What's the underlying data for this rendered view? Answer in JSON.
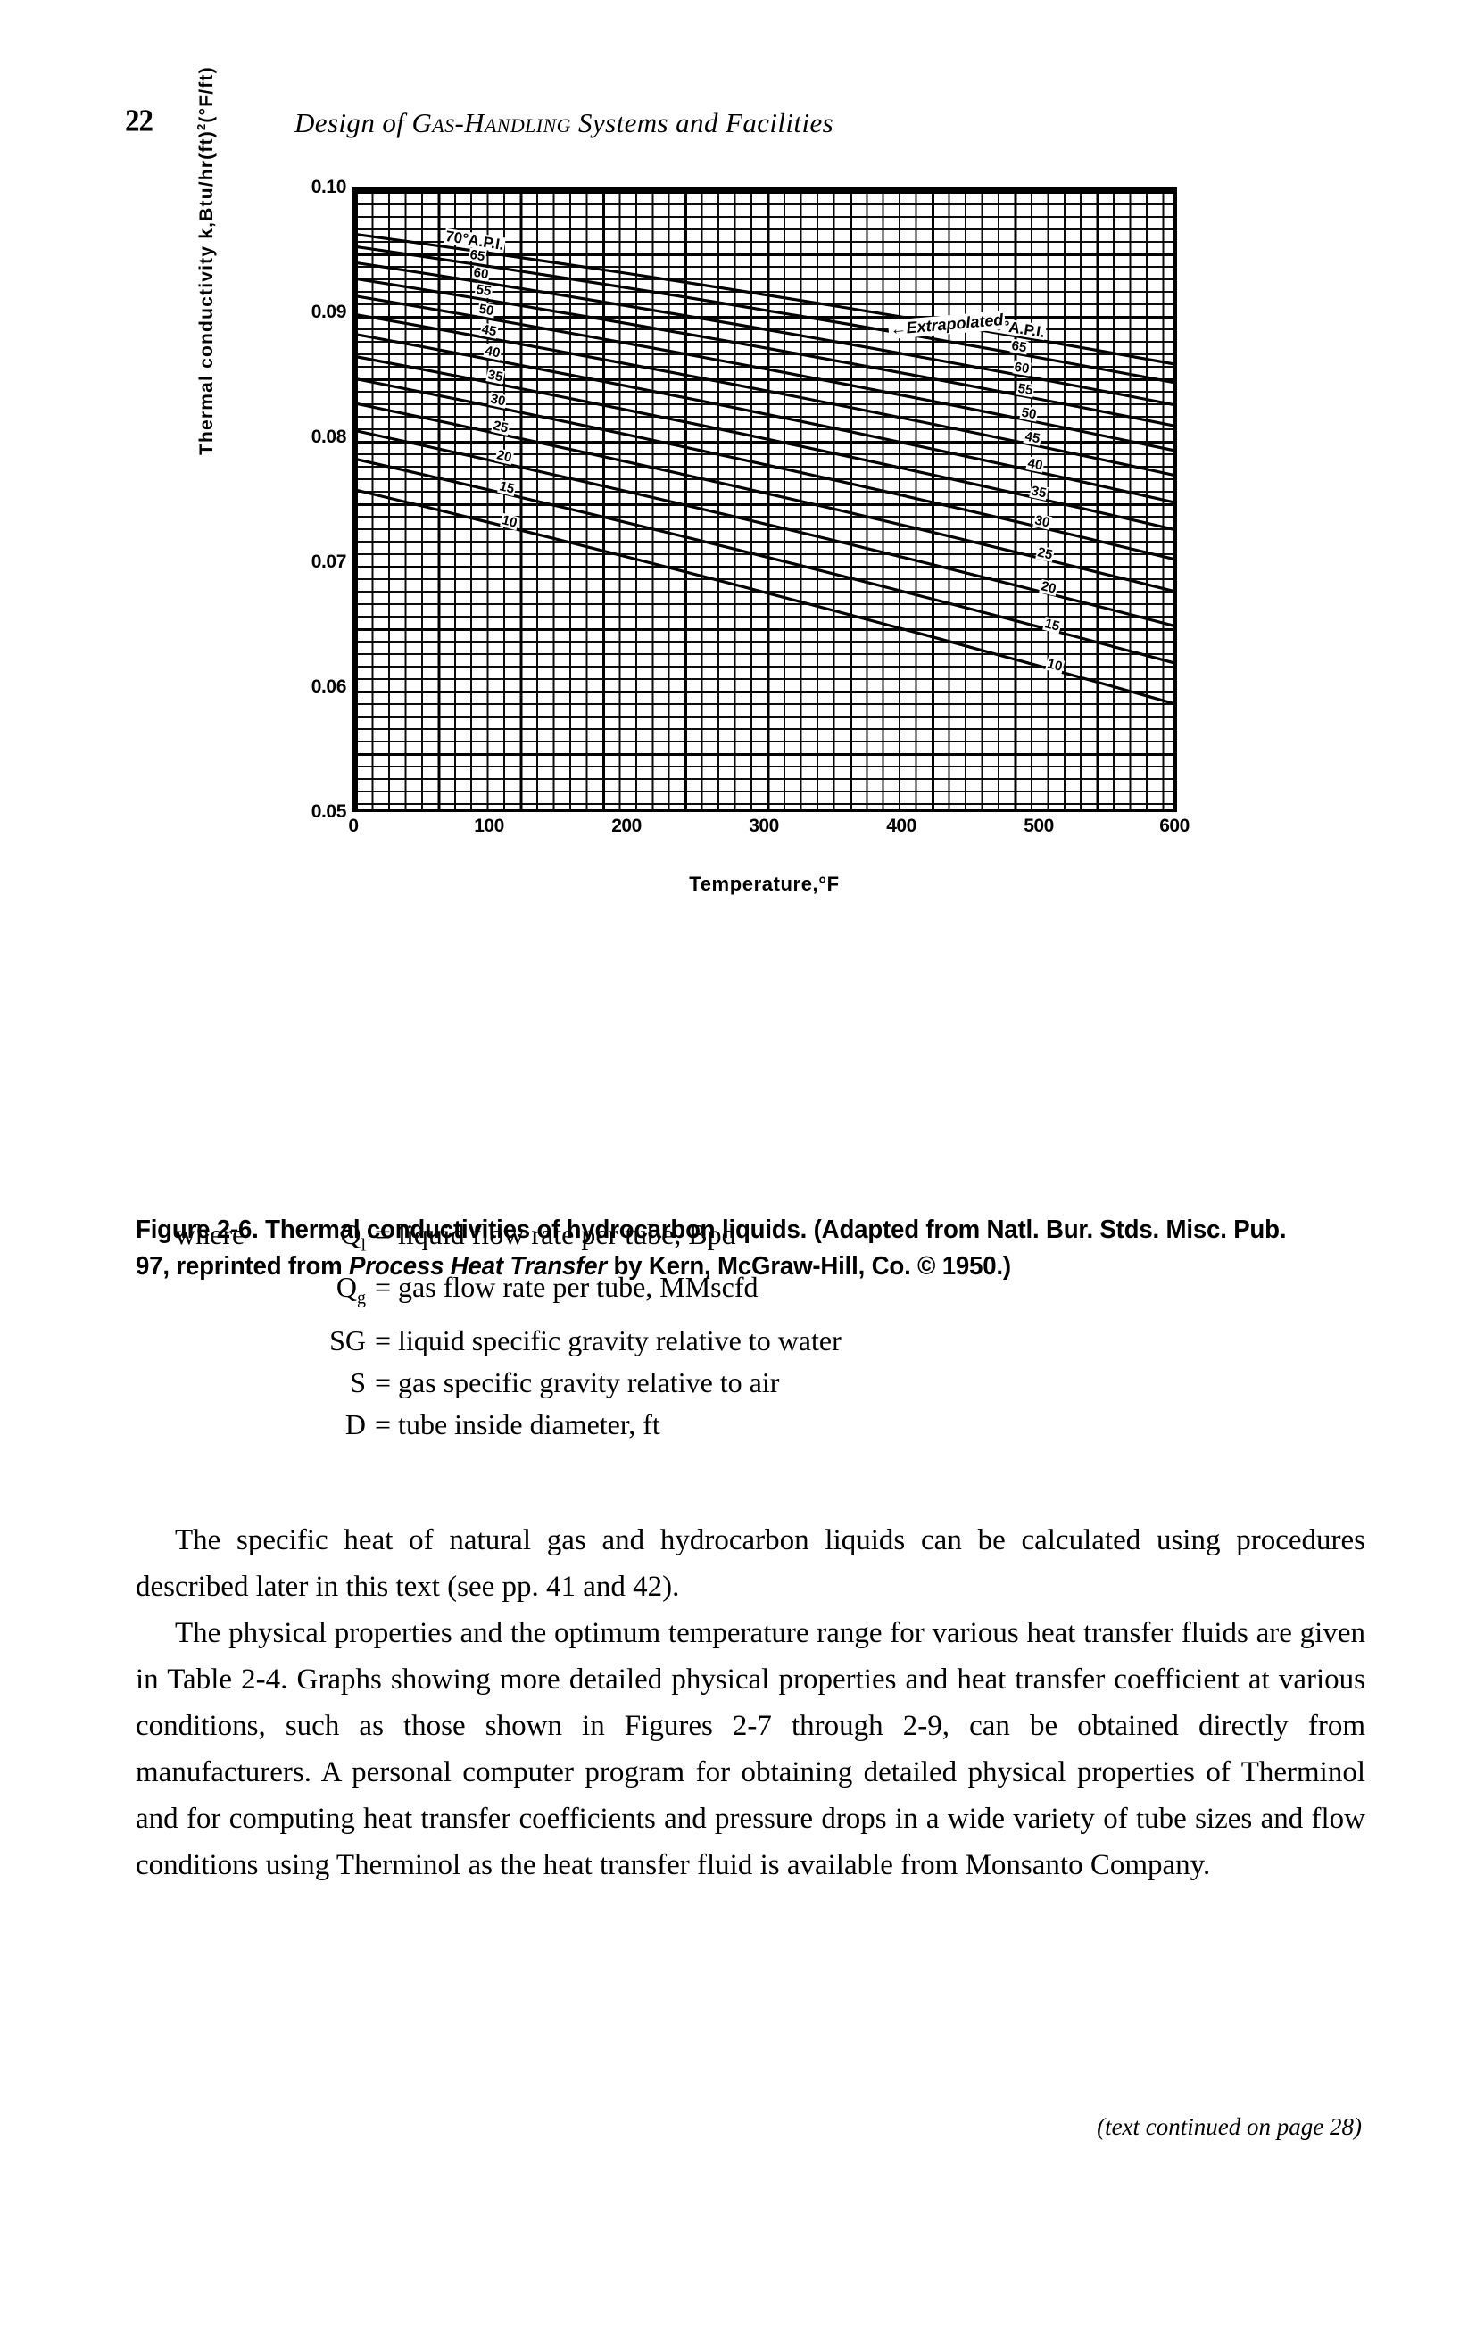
{
  "page": {
    "folio": "22",
    "running_head_prefix": "Design of ",
    "running_head_smallcaps": "Gas-Handling",
    "running_head_suffix": " Systems and Facilities",
    "footer_note": "(text continued on page 28)"
  },
  "figure": {
    "caption_line1": "Figure 2-6. Thermal conductivities of hydrocarbon liquids. (Adapted from Natl. Bur.",
    "caption_line2_a": "Stds. Misc. Pub. 97, reprinted from ",
    "caption_line2_italic": "Process Heat Transfer",
    "caption_line2_b": " by Kern, McGraw-Hill,",
    "caption_line3": "Co. © 1950.)",
    "annotation_extrapolated": "Extrapolated",
    "annotation_arrow": "←"
  },
  "chart_data": {
    "type": "line",
    "title": "Thermal conductivities of hydrocarbon liquids",
    "xlabel": "Temperature,°F",
    "ylabel_main": "Thermal conductivity ",
    "ylabel_units_pre": "k,Btu/hr(ft)",
    "ylabel_units_sup": "2",
    "ylabel_units_post": "(°F/ft)",
    "xlim": [
      0,
      600
    ],
    "ylim": [
      0.05,
      0.1
    ],
    "xticks": [
      0,
      100,
      200,
      300,
      400,
      500,
      600
    ],
    "xticklabels": [
      "0",
      "100",
      "200",
      "300",
      "400",
      "500",
      "600"
    ],
    "yticks": [
      0.1,
      0.09,
      0.08,
      0.07,
      0.06,
      0.05
    ],
    "yticklabels": [
      "0.10",
      "0.09",
      "0.08",
      "0.07",
      "0.06",
      "0.05"
    ],
    "grid": true,
    "grid_minor": true,
    "legend": "inline-curve-labels",
    "series_unit": "°API gravity",
    "series": [
      {
        "name": "70°A.P.I.",
        "label_left": "70°A.P.I.",
        "label_right": "70°A.P.I.",
        "x": [
          0,
          600
        ],
        "values": [
          0.0965,
          0.086
        ]
      },
      {
        "name": "65",
        "label_left": "65",
        "label_right": "65",
        "x": [
          0,
          600
        ],
        "values": [
          0.0955,
          0.0845
        ]
      },
      {
        "name": "60",
        "label_left": "60",
        "label_right": "60",
        "x": [
          0,
          600
        ],
        "values": [
          0.0942,
          0.0827
        ]
      },
      {
        "name": "55",
        "label_left": "55",
        "label_right": "55",
        "x": [
          0,
          600
        ],
        "values": [
          0.0929,
          0.081
        ]
      },
      {
        "name": "50",
        "label_left": "50",
        "label_right": "50",
        "x": [
          0,
          600
        ],
        "values": [
          0.0915,
          0.079
        ]
      },
      {
        "name": "45",
        "label_left": "45",
        "label_right": "45",
        "x": [
          0,
          600
        ],
        "values": [
          0.09,
          0.077
        ]
      },
      {
        "name": "40",
        "label_left": "40",
        "label_right": "40",
        "x": [
          0,
          600
        ],
        "values": [
          0.0884,
          0.0748
        ]
      },
      {
        "name": "35",
        "label_left": "35",
        "label_right": "35",
        "x": [
          0,
          600
        ],
        "values": [
          0.0866,
          0.0726
        ]
      },
      {
        "name": "30",
        "label_left": "30",
        "label_right": "30",
        "x": [
          0,
          600
        ],
        "values": [
          0.0848,
          0.0702
        ]
      },
      {
        "name": "25",
        "label_left": "25",
        "label_right": "25",
        "x": [
          0,
          600
        ],
        "values": [
          0.0828,
          0.0676
        ]
      },
      {
        "name": "20",
        "label_left": "20",
        "label_right": "20",
        "x": [
          0,
          600
        ],
        "values": [
          0.0806,
          0.0648
        ]
      },
      {
        "name": "15",
        "label_left": "15",
        "label_right": "15",
        "x": [
          0,
          600
        ],
        "values": [
          0.0783,
          0.0618
        ]
      },
      {
        "name": "10",
        "label_left": "10",
        "label_right": "10",
        "x": [
          0,
          600
        ],
        "values": [
          0.0758,
          0.0585
        ]
      }
    ],
    "annotations": [
      {
        "text": "Extrapolated",
        "x": 430,
        "y": 0.0893
      }
    ]
  },
  "where_block": {
    "keyword": "where",
    "rows": [
      {
        "symbol": "Q",
        "subscript": "l",
        "definition": "= liquid flow rate per tube, Bpd"
      },
      {
        "symbol": "Q",
        "subscript": "g",
        "definition": "= gas flow rate per tube, MMscfd"
      },
      {
        "symbol": "SG",
        "subscript": "",
        "definition": "= liquid specific gravity relative to water"
      },
      {
        "symbol": "S",
        "subscript": "",
        "definition": "= gas specific gravity relative to air"
      },
      {
        "symbol": "D",
        "subscript": "",
        "definition": "= tube inside diameter, ft"
      }
    ]
  },
  "body": {
    "paragraph1": "The specific heat of natural gas and hydrocarbon liquids can be calculated using procedures described later in this text (see pp. 41 and 42).",
    "paragraph2": "The physical properties and the optimum temperature range for various heat transfer fluids are given in Table 2-4. Graphs showing more detailed physical properties and heat transfer coefficient at various conditions, such as those shown in Figures 2-7 through 2-9, can be obtained directly from manufacturers. A personal computer program for obtaining detailed physical properties of Therminol and for computing heat transfer coefficients and pressure drops in a wide variety of tube sizes and flow conditions using Therminol as the heat transfer fluid is available from Monsanto Company."
  }
}
